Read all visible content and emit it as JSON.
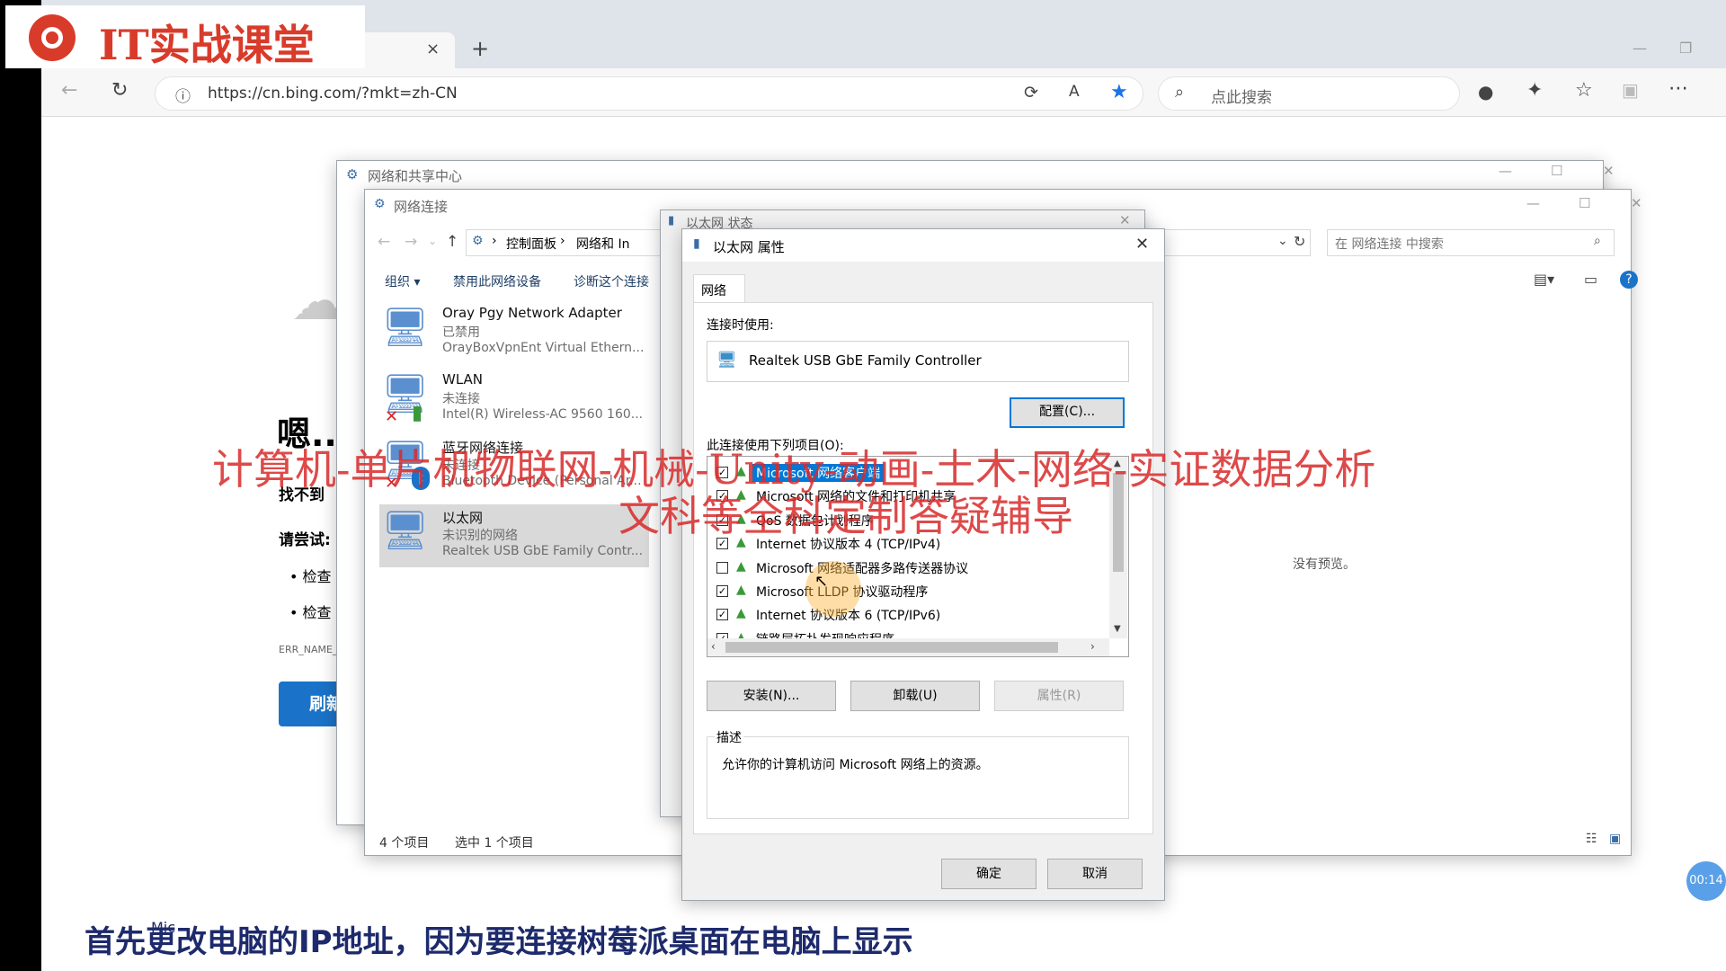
{
  "logo": {
    "text": "IT实战课堂"
  },
  "browser": {
    "tab_close": "×",
    "new_tab": "+",
    "url": "https://cn.bing.com/?mkt=zh-CN",
    "search_placeholder": "点此搜索"
  },
  "bing_page": {
    "heading": "嗯...",
    "not_found": "找不到",
    "try_label": "请尝试:",
    "bullet1": "检查",
    "bullet2": "检查",
    "error_code": "ERR_NAME_",
    "refresh_button": "刷新"
  },
  "sharing_center": {
    "title": "网络和共享中心"
  },
  "net_conn": {
    "title": "网络连接",
    "breadcrumb": [
      "控制面板",
      "网络和 In"
    ],
    "search_placeholder": "在 网络连接 中搜索",
    "toolbar": [
      "组织 ▾",
      "禁用此网络设备",
      "诊断这个连接"
    ],
    "no_preview": "没有预览。",
    "status_count": "4 个项目",
    "status_selected": "选中 1 个项目",
    "adapters": [
      {
        "name": "Oray Pgy Network Adapter",
        "status": "已禁用",
        "device": "OrayBoxVpnEnt Virtual Ethern..."
      },
      {
        "name": "WLAN",
        "status": "未连接",
        "device": "Intel(R) Wireless-AC 9560 160..."
      },
      {
        "name": "蓝牙网络连接",
        "status": "未连接",
        "device": "Bluetooth Device (Personal Ar..."
      },
      {
        "name": "以太网",
        "status": "未识别的网络",
        "device": "Realtek USB GbE Family Contr..."
      }
    ]
  },
  "eth_status": {
    "title": "以太网 状态"
  },
  "eth_props": {
    "title": "以太网 属性",
    "tab": "网络",
    "connect_using_label": "连接时使用:",
    "adapter": "Realtek USB GbE Family Controller",
    "configure_button": "配置(C)...",
    "items_label": "此连接使用下列项目(O):",
    "items": [
      {
        "label": "Microsoft 网络客户端",
        "checked": true
      },
      {
        "label": "Microsoft 网络的文件和打印机共享",
        "checked": true
      },
      {
        "label": "QoS 数据包计划程序",
        "checked": true
      },
      {
        "label": "Internet 协议版本 4 (TCP/IPv4)",
        "checked": true
      },
      {
        "label": "Microsoft 网络适配器多路传送器协议",
        "checked": false
      },
      {
        "label": "Microsoft LLDP 协议驱动程序",
        "checked": true
      },
      {
        "label": "Internet 协议版本 6 (TCP/IPv6)",
        "checked": true
      },
      {
        "label": "链路层拓扑发现响应程序",
        "checked": true
      }
    ],
    "install_button": "安装(N)...",
    "uninstall_button": "卸载(U)",
    "properties_button": "属性(R)",
    "description_label": "描述",
    "description_text": "允许你的计算机访问 Microsoft 网络上的资源。",
    "ok_button": "确定",
    "cancel_button": "取消"
  },
  "overlay": {
    "line1": "计算机-单片机物联网-机械-Unity-动画-土木-网络-实证数据分析",
    "line2": "文科等全科定制答疑辅导"
  },
  "subtitle": {
    "text": "首先更改电脑的IP地址，因为要连接树莓派桌面在电脑上显示",
    "prefix": "Mic"
  },
  "timer": "00:14"
}
